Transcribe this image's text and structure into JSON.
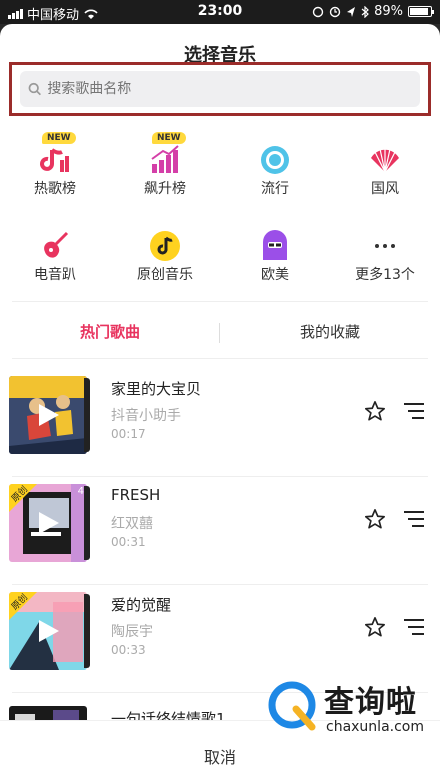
{
  "status_bar": {
    "carrier": "中国移动",
    "time": "23:00",
    "battery": "89%"
  },
  "title": "选择音乐",
  "search": {
    "placeholder": "搜索歌曲名称",
    "value": ""
  },
  "categories": [
    {
      "label": "热歌榜",
      "icon": "hot-music-icon",
      "badge": "NEW"
    },
    {
      "label": "飙升榜",
      "icon": "rising-chart-icon",
      "badge": "NEW"
    },
    {
      "label": "流行",
      "icon": "pop-disc-icon",
      "badge": ""
    },
    {
      "label": "国风",
      "icon": "chinese-fan-icon",
      "badge": ""
    },
    {
      "label": "电音趴",
      "icon": "electric-guitar-icon",
      "badge": ""
    },
    {
      "label": "原创音乐",
      "icon": "original-music-icon",
      "badge": ""
    },
    {
      "label": "欧美",
      "icon": "western-avatar-icon",
      "badge": ""
    },
    {
      "label": "更多13个",
      "icon": "more-dots-icon",
      "badge": ""
    }
  ],
  "tabs": [
    {
      "label": "热门歌曲",
      "active": true
    },
    {
      "label": "我的收藏",
      "active": false
    }
  ],
  "songs": [
    {
      "title": "家里的大宝贝",
      "artist": "抖音小助手",
      "duration": "00:17",
      "original": false,
      "extra": ""
    },
    {
      "title": "FRESH",
      "artist": "红双囍",
      "duration": "00:31",
      "original": true,
      "extra": "4"
    },
    {
      "title": "爱的觉醒",
      "artist": "陶辰宇",
      "duration": "00:33",
      "original": true,
      "extra": ""
    },
    {
      "title": "一句话终结情歌1",
      "artist": "",
      "duration": "",
      "original": false,
      "extra": ""
    }
  ],
  "original_tag": "原创",
  "cancel_label": "取消",
  "watermark": {
    "title": "查询啦",
    "subtitle": "chaxunla.com"
  },
  "colors": {
    "accent": "#e8345f",
    "highlight_border": "#9b2c2a",
    "badge": "#ffd93d"
  }
}
